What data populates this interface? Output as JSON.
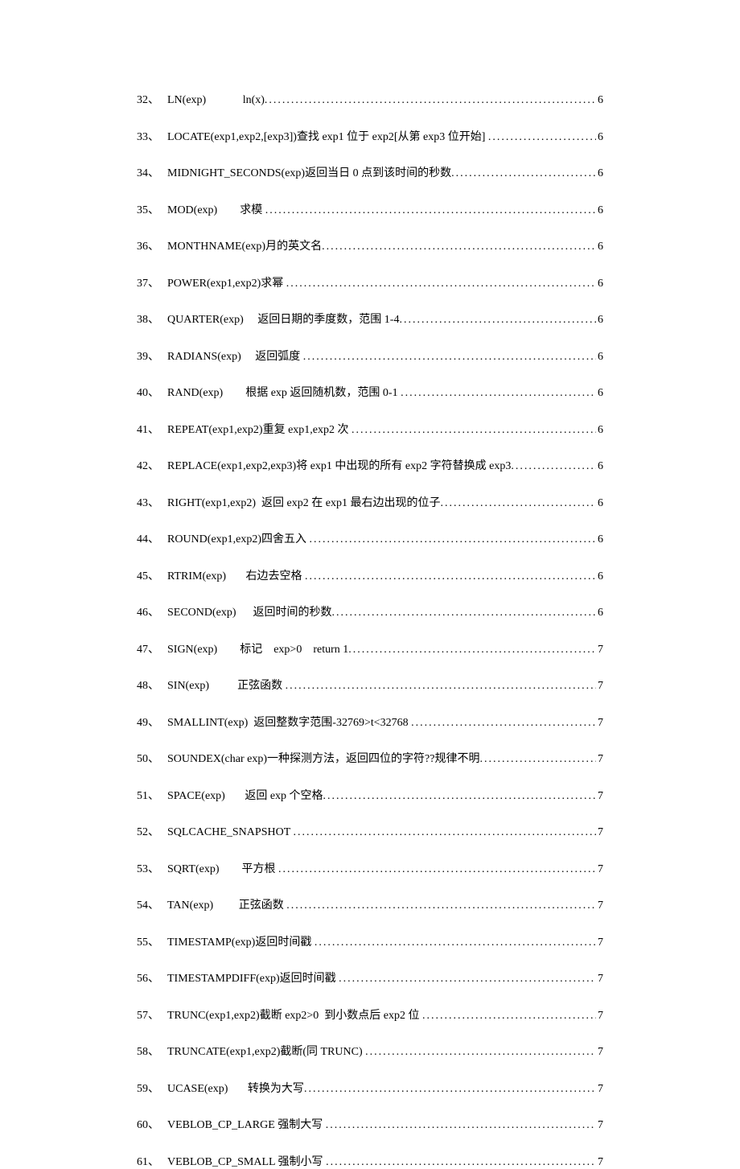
{
  "toc": [
    {
      "num": "32、",
      "text": "LN(exp)             ln(x)",
      "page": "6"
    },
    {
      "num": "33、",
      "text": "LOCATE(exp1,exp2,[exp3])查找 exp1 位于 exp2[从第 exp3 位开始] ",
      "page": "6"
    },
    {
      "num": "34、",
      "text": "MIDNIGHT_SECONDS(exp)返回当日 0 点到该时间的秒数",
      "page": "6"
    },
    {
      "num": "35、",
      "text": "MOD(exp)        求模 ",
      "page": "6"
    },
    {
      "num": "36、",
      "text": "MONTHNAME(exp)月的英文名",
      "page": "6"
    },
    {
      "num": "37、",
      "text": "POWER(exp1,exp2)求幂 ",
      "page": "6"
    },
    {
      "num": "38、",
      "text": "QUARTER(exp)     返回日期的季度数，范围 1-4",
      "page": "6"
    },
    {
      "num": "39、",
      "text": "RADIANS(exp)     返回弧度 ",
      "page": "6"
    },
    {
      "num": "40、",
      "text": "RAND(exp)        根据 exp 返回随机数，范围 0-1 ",
      "page": "6"
    },
    {
      "num": "41、",
      "text": "REPEAT(exp1,exp2)重复 exp1,exp2 次 ",
      "page": "6"
    },
    {
      "num": "42、",
      "text": "REPLACE(exp1,exp2,exp3)将 exp1 中出现的所有 exp2 字符替换成 exp3",
      "page": "6"
    },
    {
      "num": "43、",
      "text": "RIGHT(exp1,exp2)  返回 exp2 在 exp1 最右边出现的位子",
      "page": "6"
    },
    {
      "num": "44、",
      "text": "ROUND(exp1,exp2)四舍五入 ",
      "page": "6"
    },
    {
      "num": "45、",
      "text": "RTRIM(exp)       右边去空格 ",
      "page": "6"
    },
    {
      "num": "46、",
      "text": "SECOND(exp)      返回时间的秒数",
      "page": "6"
    },
    {
      "num": "47、",
      "text": "SIGN(exp)        标记    exp>0    return 1",
      "page": "7"
    },
    {
      "num": "48、",
      "text": "SIN(exp)          正弦函数 ",
      "page": "7"
    },
    {
      "num": "49、",
      "text": "SMALLINT(exp)  返回整数字范围-32769>t<32768 ",
      "page": "7"
    },
    {
      "num": "50、",
      "text": "SOUNDEX(char exp)一种探测方法，返回四位的字符??规律不明",
      "page": "7"
    },
    {
      "num": "51、",
      "text": "SPACE(exp)       返回 exp 个空格",
      "page": "7"
    },
    {
      "num": "52、",
      "text": "SQLCACHE_SNAPSHOT ",
      "page": "7"
    },
    {
      "num": "53、",
      "text": "SQRT(exp)        平方根 ",
      "page": "7"
    },
    {
      "num": "54、",
      "text": "TAN(exp)         正弦函数 ",
      "page": "7"
    },
    {
      "num": "55、",
      "text": "TIMESTAMP(exp)返回时间戳 ",
      "page": "7"
    },
    {
      "num": "56、",
      "text": "TIMESTAMPDIFF(exp)返回时间戳 ",
      "page": "7"
    },
    {
      "num": "57、",
      "text": "TRUNC(exp1,exp2)截断 exp2>0  到小数点后 exp2 位 ",
      "page": "7"
    },
    {
      "num": "58、",
      "text": "TRUNCATE(exp1,exp2)截断(同 TRUNC) ",
      "page": "7"
    },
    {
      "num": "59、",
      "text": "UCASE(exp)       转换为大写",
      "page": "7"
    },
    {
      "num": "60、",
      "text": "VEBLOB_CP_LARGE 强制大写 ",
      "page": "7"
    },
    {
      "num": "61、",
      "text": "VEBLOB_CP_SMALL 强制小写 ",
      "page": "7"
    }
  ]
}
